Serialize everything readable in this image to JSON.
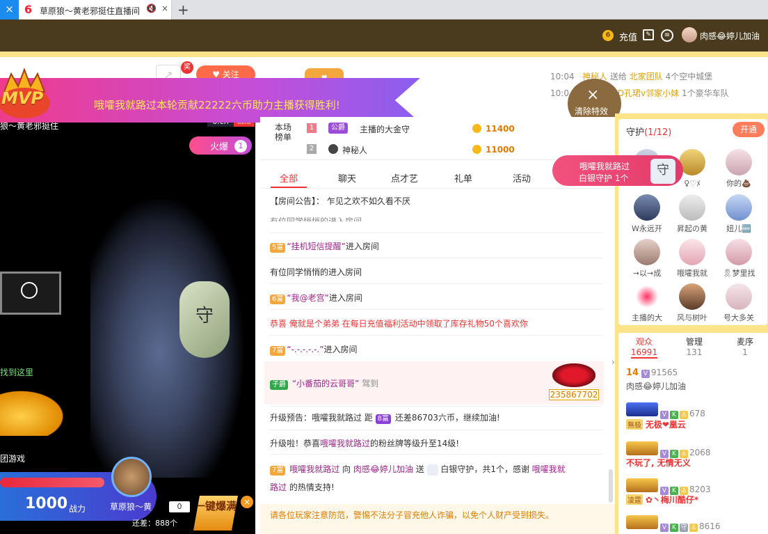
{
  "browser": {
    "tab_close": "×",
    "tab_title": "草原狼～黄老邪挺住直播间",
    "tab_mute": "🔇",
    "tab_x": "×",
    "new_tab": "+"
  },
  "header": {
    "coin_glyph": "6",
    "recharge": "充值",
    "username": "肉感😂婷儿加油"
  },
  "banner": {
    "mvp": "MVP",
    "text": "哦嚯我就路过本轮贡献22222六币助力主播获得胜利!"
  },
  "clear_effects": {
    "x": "×",
    "label": "清除特效"
  },
  "share": {
    "badge": "奖"
  },
  "follow": {
    "label": "♥ 关注"
  },
  "gift_feed": [
    {
      "time": "10:04",
      "user": "神秘人",
      "verb": "送给",
      "target": "北家团队",
      "gift": "4个空中城堡"
    },
    {
      "time": "10:0",
      "user": "",
      "verb": "给",
      "target": "@D孔珺v邻家小妹",
      "gift": "1个豪华车队"
    }
  ],
  "rank": {
    "label": "本场榜单",
    "rows": [
      {
        "num": "1",
        "badge": "公爵",
        "name": "主播的大金守",
        "value": "11400"
      },
      {
        "num": "2",
        "badge": "",
        "name": "神秘人",
        "value": "11000"
      }
    ]
  },
  "chat_tabs": [
    "全部",
    "聊天",
    "点才艺",
    "礼单",
    "活动"
  ],
  "chat": {
    "announcement": "【房间公告】：  乍见之欢不如久看不厌",
    "cut_line": "有位同学悄悄的进入房间",
    "m1_lvl": "5富",
    "m1_name": "“挂机短信提醒”",
    "m1_act": "进入房间",
    "m2": "有位同学悄悄的进入房间",
    "m3_lvl": "6富",
    "m3_name": "“我@老宫”",
    "m3_act": "进入房间",
    "m4": "恭喜 俺就是个弟弟 在每日充值福利活动中领取了库存礼物50个喜欢你",
    "m5_lvl": "7富",
    "m5_name": "“-.-.-.-.-.”",
    "m5_act": "进入房间",
    "m6_badge": "子爵",
    "m6_name": "“小番茄的云哥哥”",
    "m6_act": " 驾到",
    "m6_car_num": "235867702",
    "m7_a": "升级预告：哦嚯我就路过 距 ",
    "m7_lvl": "8富",
    "m7_b": " 还差86703六币，继续加油!",
    "m8_a": "升级啦！恭喜",
    "m8_name": "哦嚯我就路过",
    "m8_b": "的粉丝牌等级升至14级!",
    "m9_lvl": "7富",
    "m9_name": "哦嚯我就路过",
    "m9_to": " 向 ",
    "m9_user": "肉感😂婷儿加油",
    "m9_send": " 送 ",
    "m9_gift": " 白银守护，共1个，感谢 ",
    "m9_name2": "哦嚯我就",
    "m9_line2a": "路过",
    "m9_line2b": " 的热情支持!"
  },
  "notice": "请各位玩家注意防范，警惕不法分子冒充他人诈骗，以免个人财产受到损失。",
  "guard": {
    "title": "守护",
    "count": "(1/12)",
    "open": "开通",
    "popup_line1": "哦嚯我就路过",
    "popup_line2": "白银守护 1个",
    "popup_icon": "守",
    "members": [
      "",
      "♀♡ﾒ",
      "你的💩",
      "W永远开",
      "昇起の黄",
      "妞儿🆕",
      "→以→成",
      "哦嚯我就",
      "🎗梦里找",
      "主播的大",
      "风与树叶",
      "号大多关"
    ]
  },
  "audience": {
    "tabs": [
      {
        "label": "观众",
        "count": "16991"
      },
      {
        "label": "管理",
        "count": "131"
      },
      {
        "label": "麦序",
        "count": "1"
      }
    ],
    "rows": [
      {
        "lvl": "14",
        "num": "91565",
        "name": "肉感😂婷儿加油"
      },
      {
        "tier": "土豪",
        "num": "678",
        "name": "无极❤凰云",
        "tag": "無极"
      },
      {
        "tier": "土豪",
        "num": "2068",
        "name": "不玩了, 无情无义"
      },
      {
        "tier": "土豪",
        "num": "8203",
        "name": "✿丶梅川酷仔*",
        "tag": "凌霆"
      },
      {
        "tier": "土豪",
        "num": "8616",
        "name": ""
      }
    ]
  },
  "video": {
    "stream_title": "狼～黄老邪挺住",
    "brand": "6.cn",
    "live": "直播",
    "hot": "火爆",
    "hot_num": "1",
    "green_text": "找到这里",
    "game_label": "团游戏",
    "power": "1000",
    "power_unit": "战力",
    "anchor": "草原狼～黄",
    "score": "0",
    "gap": "还差：888个",
    "onekey": "一键爆满",
    "close": "×",
    "shield": "守"
  },
  "colors": {
    "accent": "#e33",
    "gold": "#fde38a",
    "header": "#4a3b1e"
  }
}
